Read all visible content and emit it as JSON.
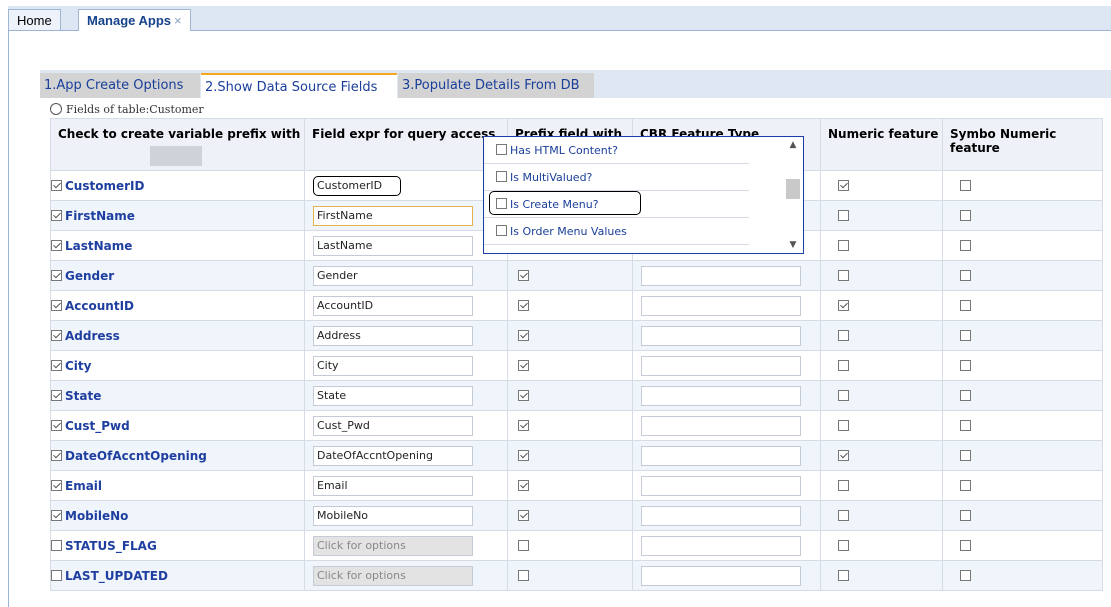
{
  "tabs": [
    {
      "label": "Home"
    },
    {
      "label": "Manage Apps",
      "close": "×"
    }
  ],
  "steps": [
    "1.App Create Options",
    "2.Show Data Source Fields",
    "3.Populate Details From DB"
  ],
  "fields_title": "Fields of table:Customer",
  "columns": [
    "Check to create variable prefix with",
    "Field expr for query access",
    "Prefix field with",
    "CBR Feature Type",
    "Numeric feature",
    "Symbo Numeric feature"
  ],
  "rows": [
    {
      "name": "CustomerID",
      "checked": true,
      "expr": "CustomerID",
      "prefix": true,
      "numeric": true,
      "symbo": false
    },
    {
      "name": "FirstName",
      "checked": true,
      "expr": "FirstName",
      "prefix": true,
      "numeric": false,
      "symbo": false
    },
    {
      "name": "LastName",
      "checked": true,
      "expr": "LastName",
      "prefix": true,
      "numeric": false,
      "symbo": false
    },
    {
      "name": "Gender",
      "checked": true,
      "expr": "Gender",
      "prefix": true,
      "numeric": false,
      "symbo": false
    },
    {
      "name": "AccountID",
      "checked": true,
      "expr": "AccountID",
      "prefix": true,
      "numeric": true,
      "symbo": false
    },
    {
      "name": "Address",
      "checked": true,
      "expr": "Address",
      "prefix": true,
      "numeric": false,
      "symbo": false
    },
    {
      "name": "City",
      "checked": true,
      "expr": "City",
      "prefix": true,
      "numeric": false,
      "symbo": false
    },
    {
      "name": "State",
      "checked": true,
      "expr": "State",
      "prefix": true,
      "numeric": false,
      "symbo": false
    },
    {
      "name": "Cust_Pwd",
      "checked": true,
      "expr": "Cust_Pwd",
      "prefix": true,
      "numeric": false,
      "symbo": false
    },
    {
      "name": "DateOfAccntOpening",
      "checked": true,
      "expr": "DateOfAccntOpening",
      "prefix": true,
      "numeric": true,
      "symbo": false
    },
    {
      "name": "Email",
      "checked": true,
      "expr": "Email",
      "prefix": true,
      "numeric": false,
      "symbo": false
    },
    {
      "name": "MobileNo",
      "checked": true,
      "expr": "MobileNo",
      "prefix": true,
      "numeric": false,
      "symbo": false
    },
    {
      "name": "STATUS_FLAG",
      "checked": false,
      "expr": "Click for options",
      "prefix": false,
      "numeric": false,
      "symbo": false
    },
    {
      "name": "LAST_UPDATED",
      "checked": false,
      "expr": "Click for options",
      "prefix": false,
      "numeric": false,
      "symbo": false
    }
  ],
  "popup": {
    "options": [
      "Has HTML Content?",
      "Is MultiValued?",
      "Is Create Menu?",
      "Is Order Menu Values"
    ]
  },
  "icons": {
    "checkbox": "checkbox-icon",
    "refresh": "refresh-icon",
    "close": "close-icon",
    "scroll-up": "scroll-up-icon",
    "scroll-down": "scroll-down-icon"
  }
}
